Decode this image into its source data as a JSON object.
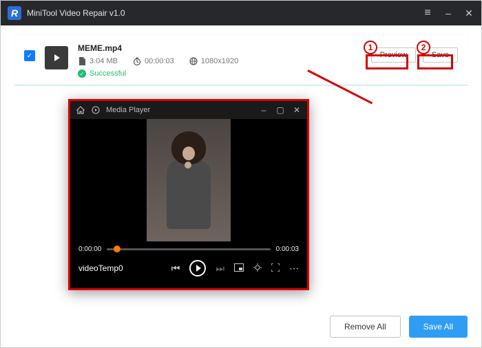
{
  "app": {
    "title": "MiniTool Video Repair v1.0",
    "logo_letter": "R"
  },
  "file": {
    "name": "MEME.mp4",
    "size": "3.04 MB",
    "duration": "00:00:03",
    "resolution": "1080x1920",
    "status": "Successful",
    "actions": {
      "preview": "Preview",
      "save": "Save"
    }
  },
  "player": {
    "title": "Media Player",
    "time_cur": "0:00:00",
    "time_end": "0:00:03",
    "video_name": "videoTemp0"
  },
  "footer": {
    "remove_all": "Remove All",
    "save_all": "Save All"
  },
  "annotation": {
    "num1": "1",
    "num2": "2"
  }
}
